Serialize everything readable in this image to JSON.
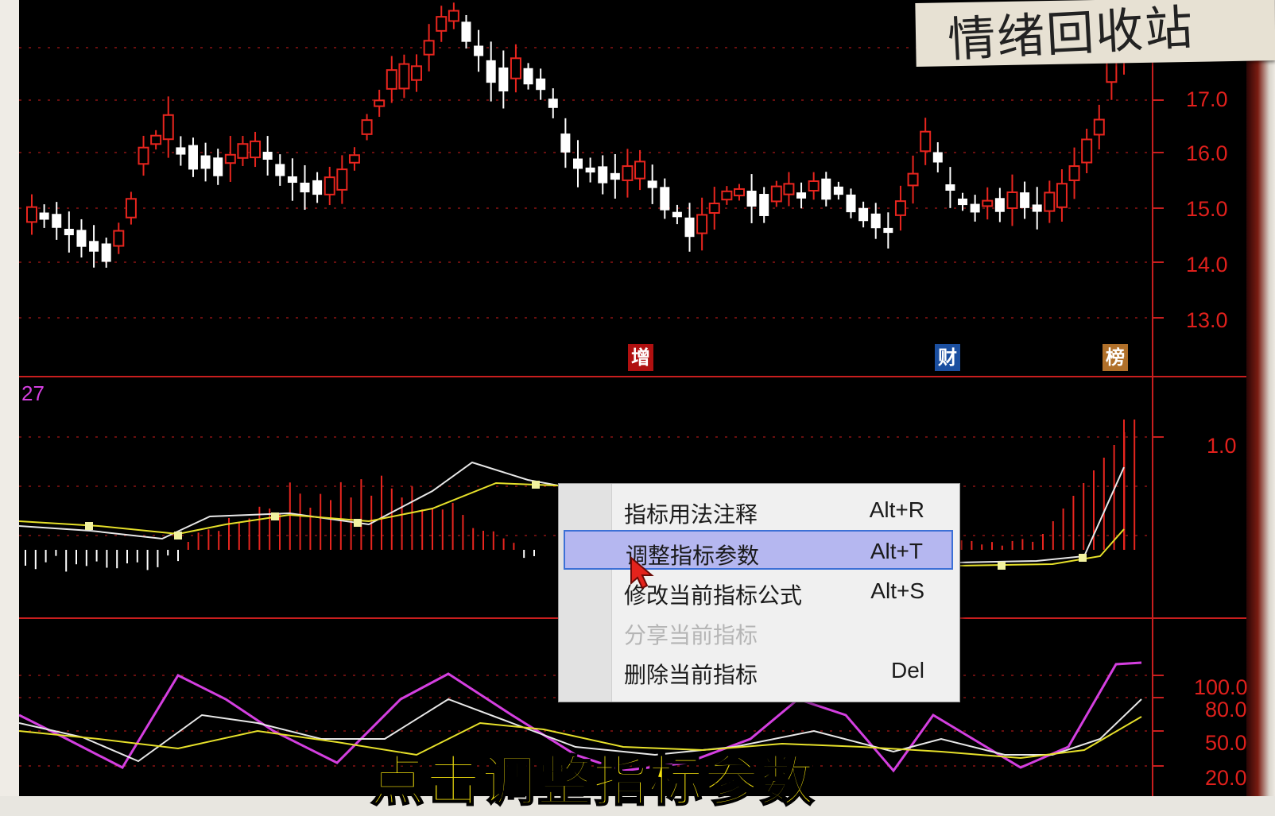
{
  "overlay_note": "情绪回收站",
  "caption": "点击调整指标参数",
  "indicator_label": "27",
  "markers": [
    {
      "text": "增",
      "color": "#b01010"
    },
    {
      "text": "财",
      "color": "#1b4fa0"
    },
    {
      "text": "榜",
      "color": "#b0702a"
    }
  ],
  "price_axis": [
    "17.0",
    "16.0",
    "15.0",
    "14.0",
    "13.0"
  ],
  "macd_axis": [
    "1.0"
  ],
  "kdj_axis": [
    "100.0",
    "80.0",
    "50.0",
    "20.0"
  ],
  "context_menu": {
    "items": [
      {
        "label": "指标用法注释",
        "shortcut": "Alt+R",
        "state": "normal"
      },
      {
        "label": "调整指标参数",
        "shortcut": "Alt+T",
        "state": "selected"
      },
      {
        "label": "修改当前指标公式",
        "shortcut": "Alt+S",
        "state": "normal"
      },
      {
        "label": "分享当前指标",
        "shortcut": "",
        "state": "disabled"
      },
      {
        "label": "删除当前指标",
        "shortcut": "Del",
        "state": "normal"
      }
    ]
  },
  "colors": {
    "up": "#e8251e",
    "down": "#ffffff",
    "grid": "#8a1414",
    "background": "#000000",
    "dif": "#e8e8e8",
    "dea": "#e6e02a",
    "k": "#e8e8e8",
    "d": "#e6e02a",
    "j": "#d43fe0"
  }
}
